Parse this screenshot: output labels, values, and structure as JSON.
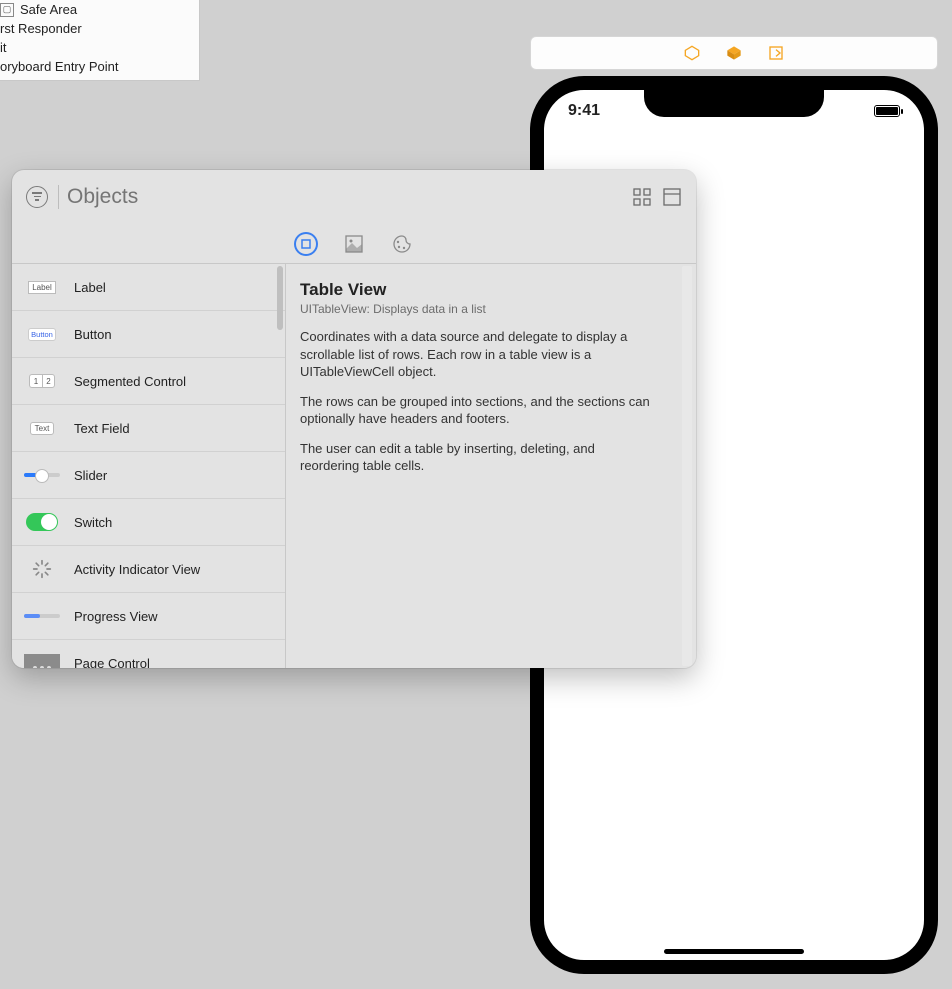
{
  "outline": {
    "items": [
      {
        "label": "Safe Area"
      },
      {
        "label": "rst Responder"
      },
      {
        "label": "it"
      },
      {
        "label": "oryboard Entry Point"
      }
    ]
  },
  "phone": {
    "time": "9:41"
  },
  "popover": {
    "search_placeholder": "Objects",
    "tabs": [
      "objects",
      "media",
      "color"
    ],
    "objects": [
      {
        "id": "label",
        "label": "Label"
      },
      {
        "id": "button",
        "label": "Button"
      },
      {
        "id": "segmented",
        "label": "Segmented Control"
      },
      {
        "id": "textfield",
        "label": "Text Field"
      },
      {
        "id": "slider",
        "label": "Slider"
      },
      {
        "id": "switch",
        "label": "Switch"
      },
      {
        "id": "activity",
        "label": "Activity Indicator View"
      },
      {
        "id": "progress",
        "label": "Progress View"
      },
      {
        "id": "pagecontrol",
        "label": "Page Control"
      }
    ],
    "detail": {
      "title": "Table View",
      "subtitle": "UITableView: Displays data in a list",
      "para1": "Coordinates with a data source and delegate to display a scrollable list of rows. Each row in a table view is a UITableViewCell object.",
      "para2": "The rows can be grouped into sections, and the sections can optionally have headers and footers.",
      "para3": "The user can edit a table by inserting, deleting, and reordering table cells."
    }
  },
  "thumbs": {
    "label_text": "Label",
    "button_text": "Button",
    "seg1": "1",
    "seg2": "2",
    "textfield_text": "Text"
  }
}
